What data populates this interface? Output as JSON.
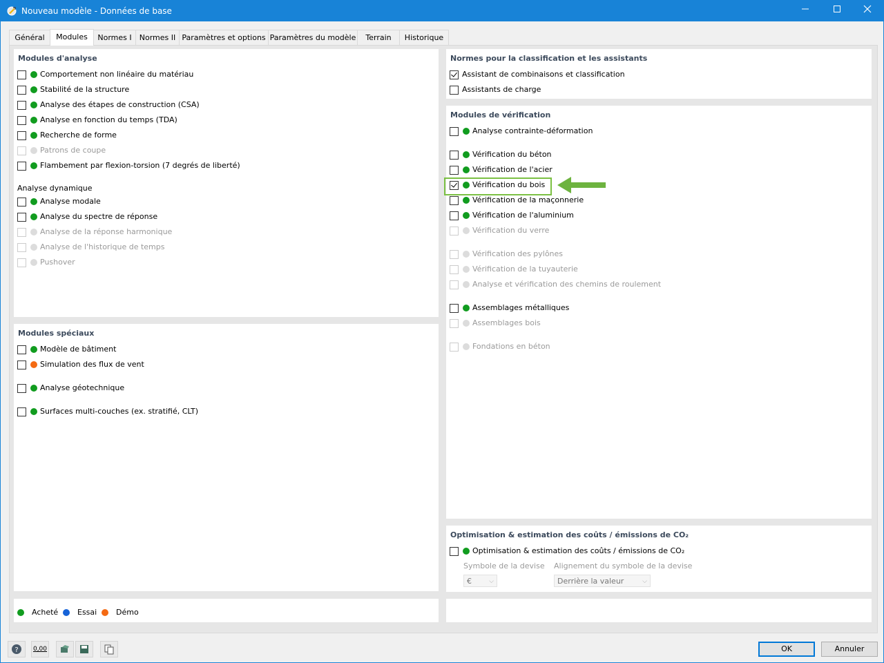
{
  "window": {
    "title": "Nouveau modèle - Données de base"
  },
  "tabs": [
    {
      "label": "Général"
    },
    {
      "label": "Modules"
    },
    {
      "label": "Normes I"
    },
    {
      "label": "Normes II"
    },
    {
      "label": "Paramètres et options"
    },
    {
      "label": "Paramètres du modèle"
    },
    {
      "label": "Terrain"
    },
    {
      "label": "Historique"
    }
  ],
  "analysis": {
    "title": "Modules d'analyse",
    "items": [
      {
        "label": "Comportement non linéaire du matériau"
      },
      {
        "label": "Stabilité de la structure"
      },
      {
        "label": "Analyse des étapes de construction (CSA)"
      },
      {
        "label": "Analyse en fonction du temps (TDA)"
      },
      {
        "label": "Recherche de forme"
      },
      {
        "label": "Patrons de coupe"
      },
      {
        "label": "Flambement par flexion-torsion (7 degrés de liberté)"
      }
    ],
    "dynamic_title": "Analyse dynamique",
    "dynamic_items": [
      {
        "label": "Analyse modale"
      },
      {
        "label": "Analyse du spectre de réponse"
      },
      {
        "label": "Analyse de la réponse harmonique"
      },
      {
        "label": "Analyse de l'historique de temps"
      },
      {
        "label": "Pushover"
      }
    ]
  },
  "special": {
    "title": "Modules spéciaux",
    "items": [
      {
        "label": "Modèle de bâtiment"
      },
      {
        "label": "Simulation des flux de vent"
      },
      {
        "label": "Analyse géotechnique"
      },
      {
        "label": "Surfaces multi-couches (ex. stratifié, CLT)"
      }
    ]
  },
  "norms": {
    "title": "Normes pour la classification et les assistants",
    "items": [
      {
        "label": "Assistant de combinaisons et classification"
      },
      {
        "label": "Assistants de charge"
      }
    ]
  },
  "design": {
    "title": "Modules de vérification",
    "items": [
      {
        "label": "Analyse contrainte-déformation"
      },
      {
        "label": "Vérification du béton"
      },
      {
        "label": "Vérification de l'acier"
      },
      {
        "label": "Vérification du bois"
      },
      {
        "label": "Vérification de la maçonnerie"
      },
      {
        "label": "Vérification de l'aluminium"
      },
      {
        "label": "Vérification du verre"
      },
      {
        "label": "Vérification des pylônes"
      },
      {
        "label": "Vérification de la tuyauterie"
      },
      {
        "label": "Analyse et vérification des chemins de roulement"
      },
      {
        "label": "Assemblages métalliques"
      },
      {
        "label": "Assemblages bois"
      },
      {
        "label": "Fondations en béton"
      }
    ]
  },
  "optim": {
    "title": "Optimisation & estimation des coûts / émissions de CO₂",
    "item": "Optimisation & estimation des coûts / émissions de CO₂",
    "currency_label": "Symbole de la devise",
    "currency_value": "€",
    "align_label": "Alignement du symbole de la devise",
    "align_value": "Derrière la valeur"
  },
  "legend": {
    "purchased": "Acheté",
    "trial": "Essai",
    "demo": "Démo"
  },
  "status_colors": {
    "purchased": "#119c1f",
    "trial": "#1663d8",
    "demo": "#f46a13",
    "unavailable": "#dcdcdc"
  },
  "buttons": {
    "ok": "OK",
    "cancel": "Annuler"
  },
  "toolbar": {
    "zero_label": "0,00"
  }
}
